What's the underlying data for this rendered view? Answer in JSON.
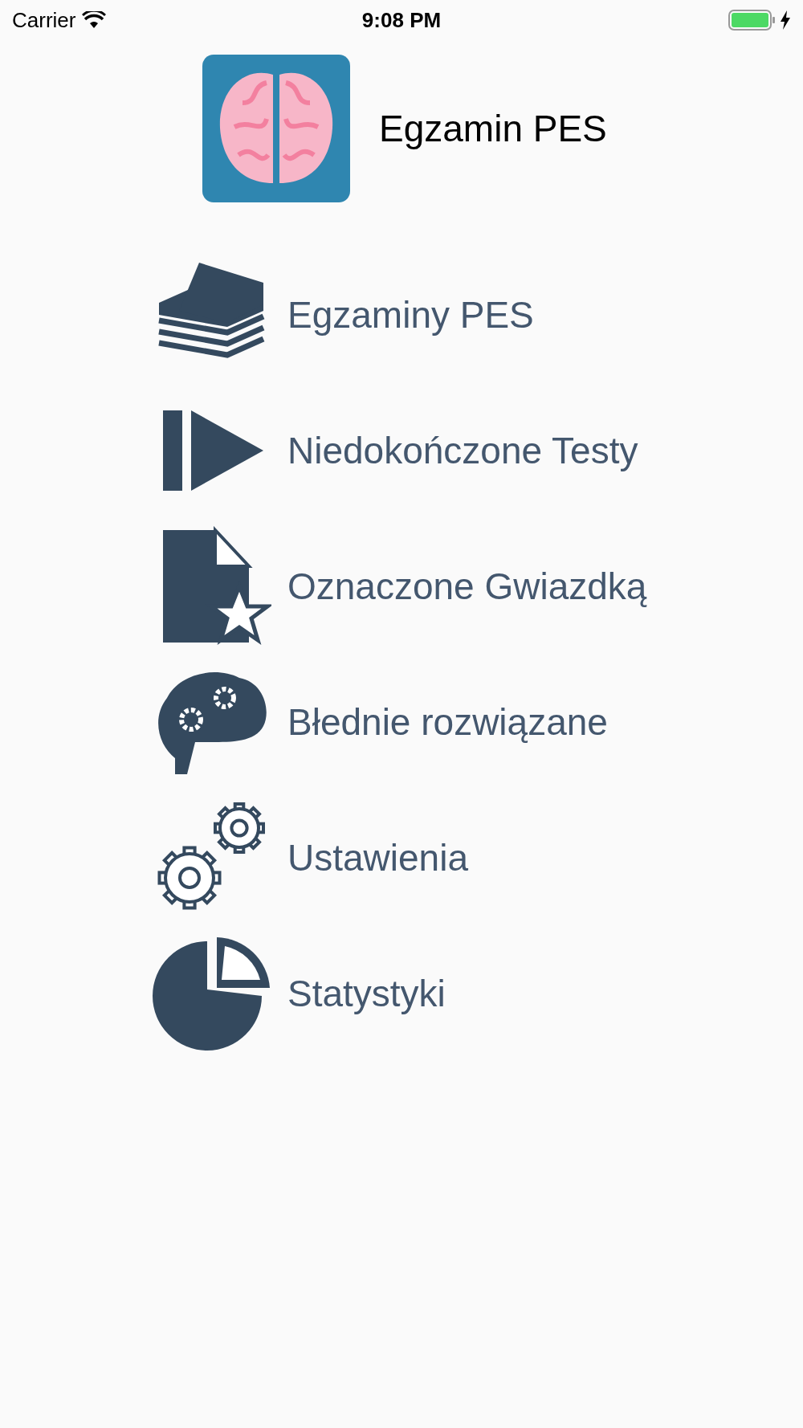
{
  "status_bar": {
    "carrier": "Carrier",
    "time": "9:08 PM"
  },
  "header": {
    "title": "Egzamin PES"
  },
  "menu": [
    {
      "label": "Egzaminy PES"
    },
    {
      "label": "Niedokończone Testy"
    },
    {
      "label": "Oznaczone Gwiazdką"
    },
    {
      "label": "Błednie rozwiązane"
    },
    {
      "label": "Ustawienia"
    },
    {
      "label": "Statystyki"
    }
  ]
}
